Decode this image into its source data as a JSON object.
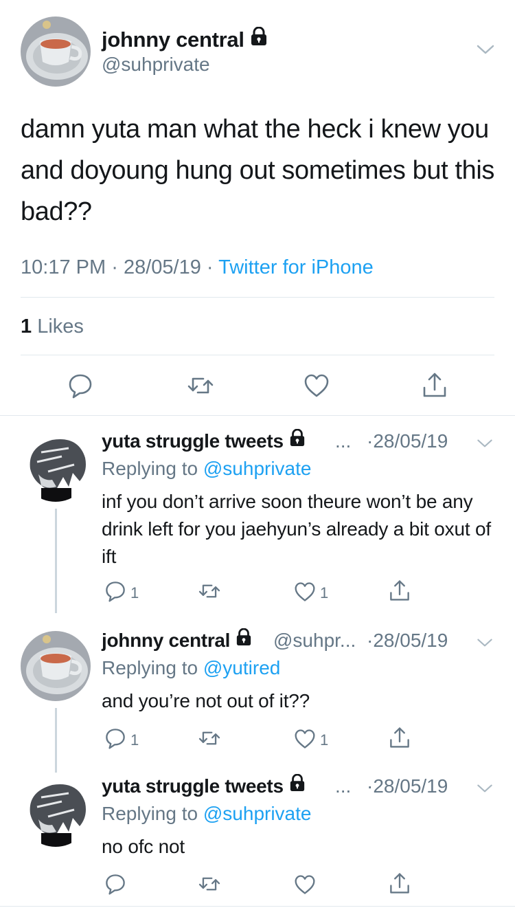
{
  "main_tweet": {
    "display_name": "johnny central",
    "handle": "@suhprivate",
    "text": "damn yuta man what the heck i knew you and doyoung hung out sometimes but this bad??",
    "time": "10:17 PM",
    "date": "28/05/19",
    "source": "Twitter for iPhone",
    "likes_count": "1",
    "likes_label": "Likes"
  },
  "replies": [
    {
      "display_name": "yuta struggle tweets",
      "handle_truncated": "...",
      "date": "28/05/19",
      "replying_prefix": "Replying to",
      "replying_to": "@suhprivate",
      "text": "inf you don’t arrive soon theure won’t be any drink left for you jaehyun’s already a bit oxut of ift",
      "reply_count": "1",
      "like_count": "1"
    },
    {
      "display_name": "johnny central",
      "handle_truncated": "@suhpr...",
      "date": "28/05/19",
      "replying_prefix": "Replying to",
      "replying_to": "@yutired",
      "text": "and you’re not out of it??",
      "reply_count": "1",
      "like_count": "1"
    },
    {
      "display_name": "yuta struggle tweets",
      "handle_truncated": "...",
      "date": "28/05/19",
      "replying_prefix": "Replying to",
      "replying_to": "@suhprivate",
      "text": "no ofc not"
    }
  ],
  "separator": "·",
  "icons": [
    "lock-icon",
    "chevron-down-icon",
    "reply-icon",
    "retweet-icon",
    "like-icon",
    "share-icon"
  ],
  "colors": {
    "text": "#14171a",
    "secondary": "#657786",
    "link": "#1da1f2",
    "divider": "#e1e8ed"
  }
}
